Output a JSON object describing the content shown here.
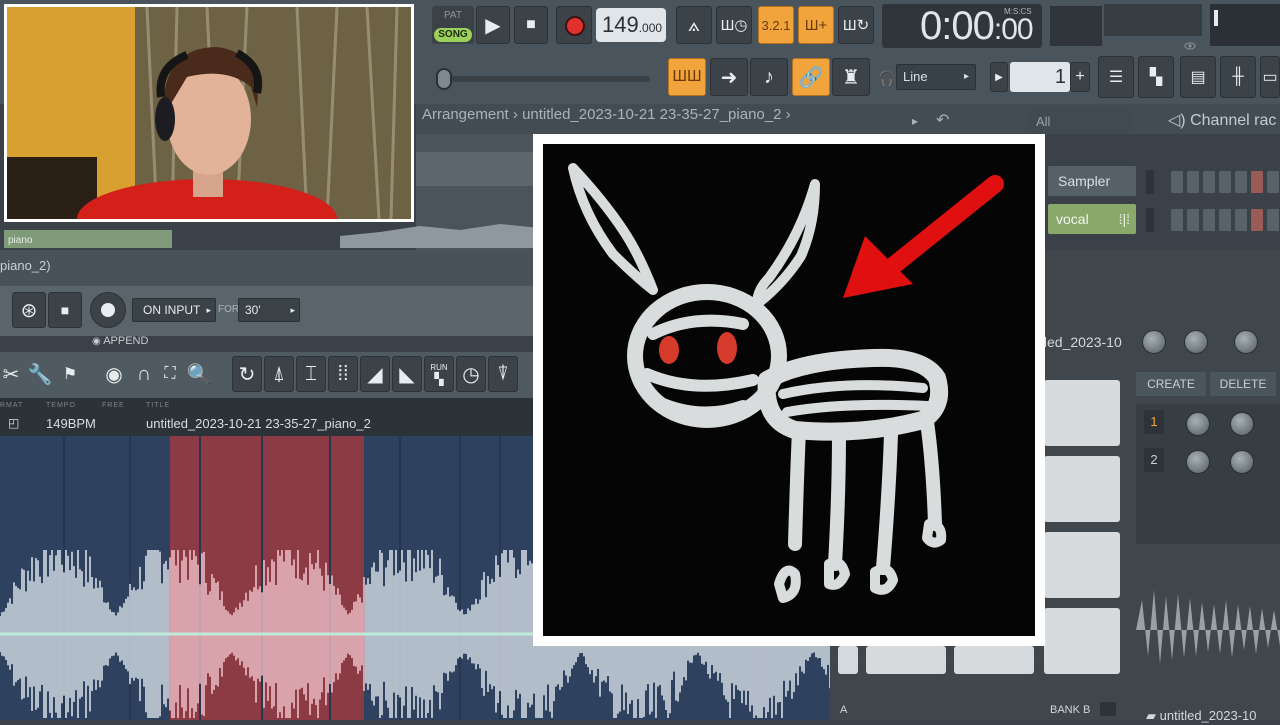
{
  "transport": {
    "pat_label": "PAT",
    "song_label": "SONG",
    "tempo": "149",
    "tempo_decimal": ".000",
    "time": "0:00",
    "time_cs": "00",
    "time_format": "M:S:CS",
    "snap_mode": "Line",
    "step_value": "1",
    "step_plus": "+"
  },
  "breadcrumb": {
    "root": "Arrangement",
    "separator": "›",
    "file": "untitled_2023-10-21 23-35-27_piano_2"
  },
  "channel_rack": {
    "filter": "All",
    "title": "Channel rac",
    "channels": [
      {
        "name": "Sampler"
      },
      {
        "name": "vocal"
      }
    ]
  },
  "edison": {
    "title": "piano_2)",
    "record_mode": "ON INPUT",
    "for_label": "FOR",
    "for_value": "30'",
    "append_label": "APPEND",
    "run_label": "RUN",
    "info": {
      "format_label": "RMAT",
      "tempo_label": "TEMPO",
      "free_label": "FREE",
      "title_label": "TITLE",
      "tempo_value": "149BPM",
      "title_value": "untitled_2023-10-21 23-35-27_piano_2"
    },
    "clip_label": "piano"
  },
  "fpc": {
    "file_name": "tled_2023-10",
    "create_label": "CREATE",
    "delete_label": "DELETE",
    "layers": [
      "1",
      "2"
    ],
    "bank_a": "A",
    "bank_b": "BANK B",
    "bottom_file": "untitled_2023-10"
  },
  "colors": {
    "accent_orange": "#f2a43c",
    "song_green": "#9bd15a",
    "selection_red": "#8c3a44",
    "arrow_red": "#e01010"
  }
}
